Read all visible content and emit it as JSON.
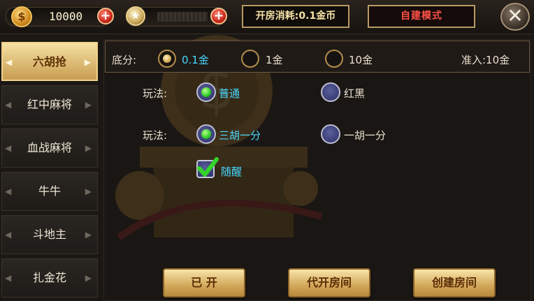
{
  "topbar": {
    "gold_amount": "10000",
    "room_cost": "开房消耗:0.1金币",
    "mode_label": "自建模式"
  },
  "sidebar": {
    "items": [
      {
        "label": "六胡抢",
        "active": true
      },
      {
        "label": "红中麻将",
        "active": false
      },
      {
        "label": "血战麻将",
        "active": false
      },
      {
        "label": "牛牛",
        "active": false
      },
      {
        "label": "斗地主",
        "active": false
      },
      {
        "label": "扎金花",
        "active": false
      }
    ]
  },
  "base_score": {
    "label": "底分:",
    "options": [
      "0.1金",
      "1金",
      "10金"
    ],
    "selected": "0.1金",
    "entry_requirement": "准入:10金"
  },
  "play_mode_1": {
    "label": "玩法:",
    "options": [
      "普通",
      "红黑"
    ],
    "selected": "普通"
  },
  "play_mode_2": {
    "label": "玩法:",
    "options": [
      "三胡一分",
      "一胡一分"
    ],
    "selected": "三胡一分"
  },
  "checkbox": {
    "label": "随醒",
    "checked": true
  },
  "buttons": {
    "opened": "已 开",
    "proxy_open": "代开房间",
    "create": "创建房间"
  },
  "colors": {
    "selected_text": "#49d8ff",
    "mode_text": "#ff5146",
    "gold_button": "#d3a85b"
  },
  "icons": {
    "gold_coin": "coin-icon",
    "diamond": "gem-icon",
    "add": "plus-icon",
    "close": "close-icon"
  }
}
